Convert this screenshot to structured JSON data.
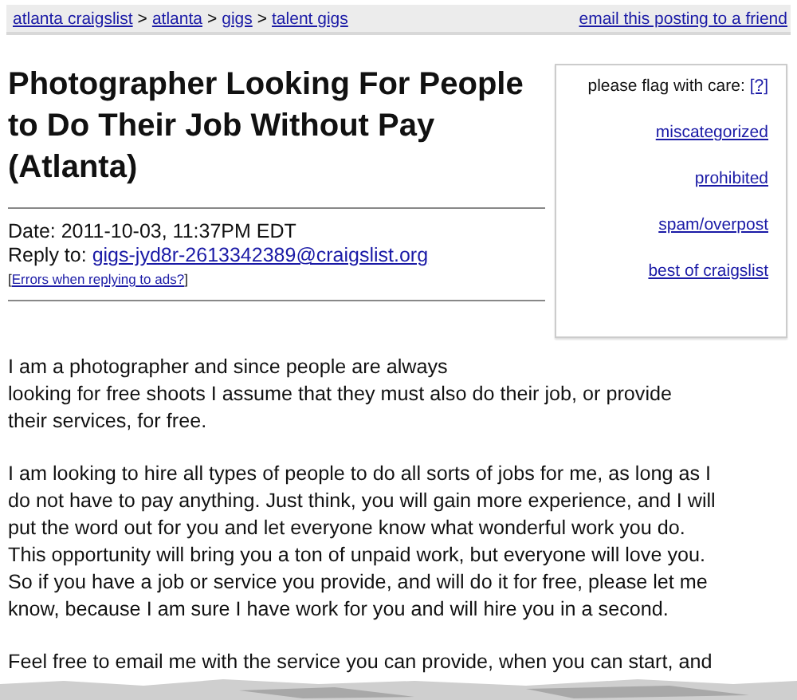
{
  "breadcrumb": [
    "atlanta craigslist",
    "atlanta",
    "gigs",
    "talent gigs"
  ],
  "breadcrumb_separator": ">",
  "email_link": "email this posting to a friend",
  "title": "Photographer Looking For People to Do Their Job Without Pay (Atlanta)",
  "date": "Date: 2011-10-03, 11:37PM EDT",
  "reply_label": "Reply to:",
  "reply_email": "gigs-jyd8r-2613342389@craigslist.org",
  "reply_help": {
    "open": "[",
    "link": "Errors when replying to ads?",
    "close": "]"
  },
  "flag_box": {
    "label": "please flag with care:",
    "help": "[?]",
    "links": [
      "miscategorized",
      "prohibited",
      "spam/overpost",
      "best of craigslist"
    ]
  },
  "body": [
    [
      "I am a photographer and since people are always",
      "looking for free shoots I assume that they must also do their job, or provide",
      "their services, for free."
    ],
    [
      "I am looking to hire all types of people to do all sorts of jobs for me, as long as I",
      "do not have to pay anything. Just think, you will gain more experience, and I will",
      "put the word out for you and let everyone know what wonderful work you do.",
      "This opportunity will bring you a ton of unpaid work, but everyone will love you.",
      "So if you have a job or service you provide, and will do it for free, please let me",
      "know, because I am sure I have work for you and will hire you in a second."
    ],
    [
      "Feel free to email me with the service you can provide, when you can start, and"
    ]
  ]
}
